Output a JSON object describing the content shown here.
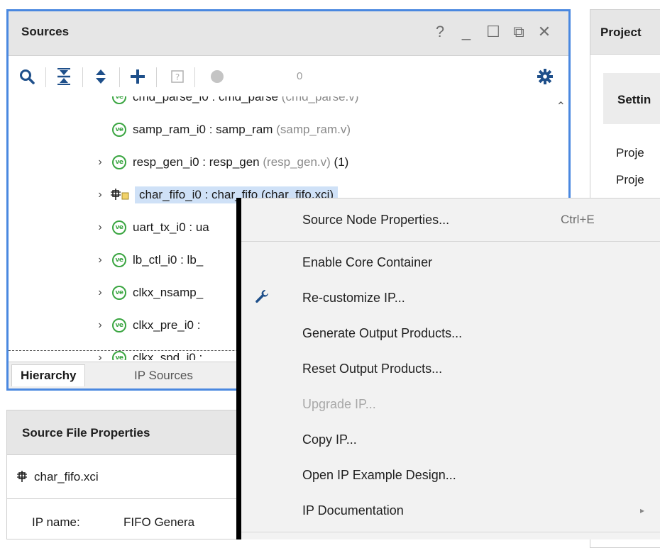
{
  "sources": {
    "title": "Sources",
    "controls": {
      "help": "?",
      "minimize": "_",
      "maximize": "☐",
      "float": "⧉",
      "close": "✕"
    },
    "toolbar": {
      "count": "0"
    },
    "tree": [
      {
        "instance": "cmd_parse_i0 : cmd_parse",
        "file": "(cmd_parse.v)",
        "count": ""
      },
      {
        "instance": "samp_ram_i0 : samp_ram",
        "file": "(samp_ram.v)",
        "count": ""
      },
      {
        "instance": "resp_gen_i0 : resp_gen",
        "file": "(resp_gen.v)",
        "count": "(1)"
      },
      {
        "instance": "char_fifo_i0 : char_fifo",
        "file": "(char_fifo.xci)",
        "count": ""
      },
      {
        "instance": "uart_tx_i0 : ua",
        "file": "",
        "count": ""
      },
      {
        "instance": "lb_ctl_i0 : lb_",
        "file": "",
        "count": ""
      },
      {
        "instance": "clkx_nsamp_",
        "file": "",
        "count": ""
      },
      {
        "instance": "clkx_pre_i0 :",
        "file": "",
        "count": ""
      },
      {
        "instance": "clkx_spd_i0 :",
        "file": "",
        "count": ""
      }
    ],
    "tabs": {
      "hierarchy": "Hierarchy",
      "ip_sources": "IP Sources"
    }
  },
  "source_file_properties": {
    "title": "Source File Properties",
    "file_name": "char_fifo.xci",
    "ip_name_label": "IP name:",
    "ip_name_value": "FIFO Genera"
  },
  "project_summary": {
    "title": "Project",
    "settings": "Settin",
    "rows": [
      "Proje",
      "Proje"
    ]
  },
  "context_menu": {
    "items": [
      {
        "label": "Source Node Properties...",
        "shortcut": "Ctrl+E",
        "disabled": false
      },
      {
        "label": "Enable Core Container",
        "shortcut": "",
        "disabled": false
      },
      {
        "label": "Re-customize IP...",
        "shortcut": "",
        "disabled": false,
        "icon": "wrench-icon"
      },
      {
        "label": "Generate Output Products...",
        "shortcut": "",
        "disabled": false
      },
      {
        "label": "Reset Output Products...",
        "shortcut": "",
        "disabled": false
      },
      {
        "label": "Upgrade IP...",
        "shortcut": "",
        "disabled": true
      },
      {
        "label": "Copy IP...",
        "shortcut": "",
        "disabled": false
      },
      {
        "label": "Open IP Example Design...",
        "shortcut": "",
        "disabled": false
      },
      {
        "label": "IP Documentation",
        "shortcut": "",
        "disabled": false,
        "submenu": "▸"
      }
    ]
  },
  "colors": {
    "accent_border": "#4a88e0",
    "selected_row": "#cfe1f7",
    "verilog_icon": "#3aa541",
    "menu_background": "#f2f2f2"
  }
}
